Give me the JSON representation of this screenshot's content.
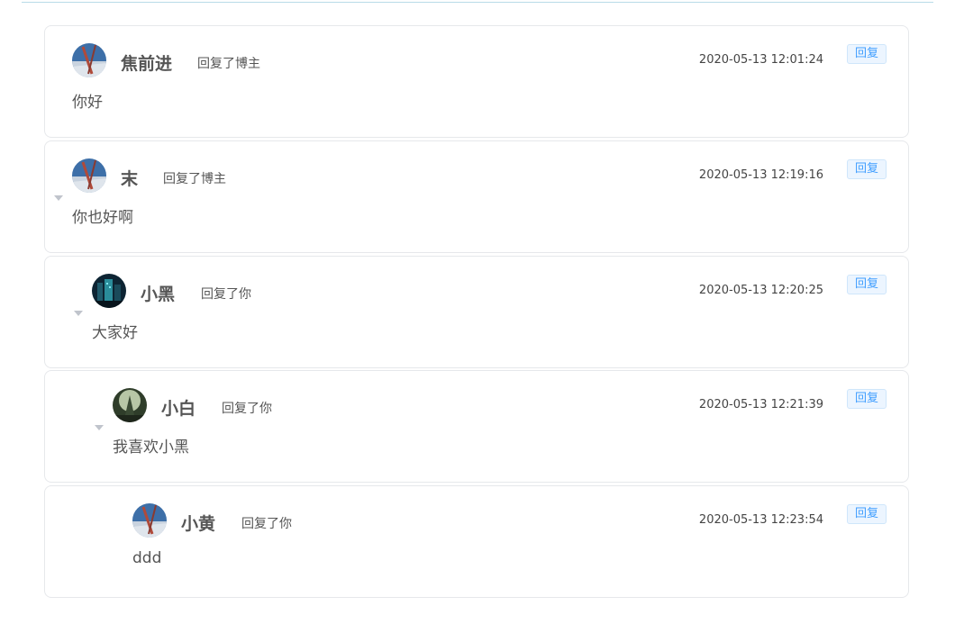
{
  "comments": [
    {
      "username": "焦前进",
      "reply_text": "回复了博主",
      "time": "2020-05-13 12:01:24",
      "content": "你好",
      "reply_button": "回复",
      "avatar": "bridge-avatar-icon"
    },
    {
      "username": "末",
      "reply_text": "回复了博主",
      "time": "2020-05-13 12:19:16",
      "content": "你也好啊",
      "reply_button": "回复",
      "avatar": "bridge-avatar-icon"
    },
    {
      "username": "小黑",
      "reply_text": "回复了你",
      "time": "2020-05-13 12:20:25",
      "content": "大家好",
      "reply_button": "回复",
      "avatar": "city-night-avatar-icon"
    },
    {
      "username": "小白",
      "reply_text": "回复了你",
      "time": "2020-05-13 12:21:39",
      "content": "我喜欢小黑",
      "reply_button": "回复",
      "avatar": "forest-avatar-icon"
    },
    {
      "username": "小黄",
      "reply_text": "回复了你",
      "time": "2020-05-13 12:23:54",
      "content": "ddd",
      "reply_button": "回复",
      "avatar": "bridge-avatar-icon"
    }
  ],
  "colors": {
    "accent": "#409eff",
    "border": "#e6e8eb",
    "divider": "#b8dbe8"
  }
}
